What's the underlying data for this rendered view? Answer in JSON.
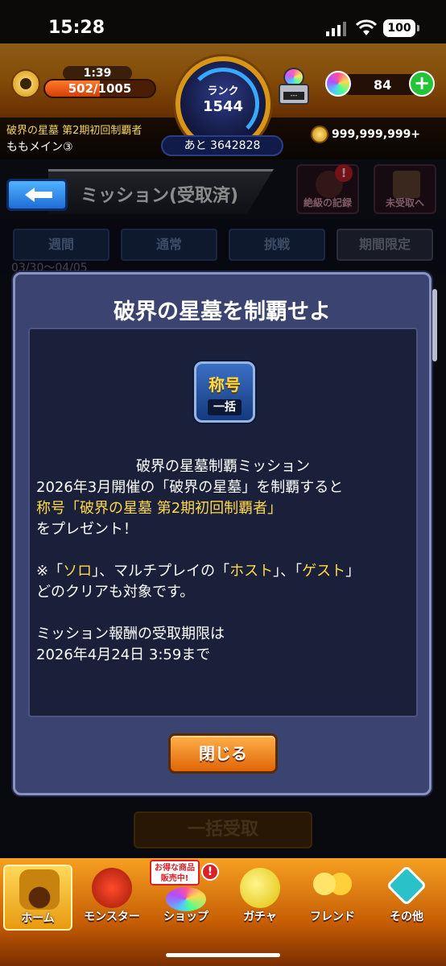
{
  "status_bar": {
    "time": "15:28",
    "battery": "100"
  },
  "header": {
    "stamina_timer": "1:39",
    "stamina": "502/1005",
    "stamina_fraction": 0.5,
    "rank_label": "ランク",
    "rank": "1544",
    "rank_remaining": "あと 3642828",
    "orb_count": "84",
    "title_name": "破界の星墓 第2期初回制覇者",
    "player_name": "ももメイン③",
    "gold": "999,999,999+"
  },
  "subheader": {
    "screen_title": "ミッション(受取済)",
    "record_label": "絶級の記録",
    "unclaimed_label": "未受取へ"
  },
  "tabs": [
    {
      "label": "週間"
    },
    {
      "label": "通常"
    },
    {
      "label": "挑戦"
    },
    {
      "label": "期間限定"
    }
  ],
  "date_range": "03/30〜04/05",
  "collect_all": "一括受取",
  "modal": {
    "title": "破界の星墓を制覇せよ",
    "icon_top": "称号",
    "icon_bottom": "一括",
    "line1": "破界の星墓制覇ミッション",
    "line2": "2026年3月開催の「破界の星墓」を制覇すると",
    "line3": "称号「破界の星墓 第2期初回制覇者」",
    "line4": "をプレゼント！",
    "line5_a": "※「",
    "line5_solo": "ソロ",
    "line5_b": "」、マルチプレイの「",
    "line5_host": "ホスト",
    "line5_c": "」、「",
    "line5_guest": "ゲスト",
    "line5_d": "」",
    "line6": "どのクリアも対象です。",
    "line7": "ミッション報酬の受取期限は",
    "line8": "2026年4月24日 3:59まで",
    "close_label": "閉じる"
  },
  "nav": {
    "promo": "お得な商品販売中!",
    "items": [
      {
        "label": "ホーム"
      },
      {
        "label": "モンスター"
      },
      {
        "label": "ショップ"
      },
      {
        "label": "ガチャ"
      },
      {
        "label": "フレンド"
      },
      {
        "label": "その他"
      }
    ]
  },
  "colors": {
    "accent_yellow": "#ffd84a",
    "modal_bg": "#3b4371",
    "close_button": "#e06508",
    "nav_bg": "#f6a021"
  }
}
